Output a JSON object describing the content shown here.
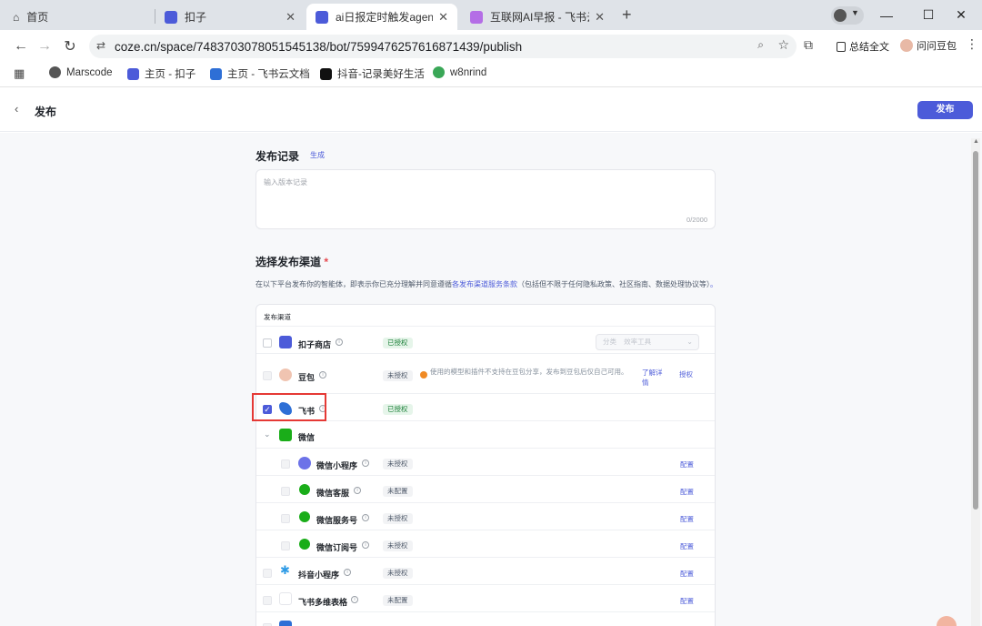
{
  "browser": {
    "tabs": [
      {
        "label": "首页"
      },
      {
        "label": "扣子"
      },
      {
        "label": "ai日报定时触发agent -"
      },
      {
        "label": "互联网AI早报 - 飞书云文"
      }
    ],
    "url": "coze.cn/space/7483703078051545138/bot/7599476257616871439/publish",
    "toolbar": {
      "summary": "总结全文",
      "assistant": "问问豆包"
    },
    "bookmarks": [
      {
        "label": "Marscode"
      },
      {
        "label": "主页 - 扣子"
      },
      {
        "label": "主页 - 飞书云文档"
      },
      {
        "label": "抖音-记录美好生活"
      },
      {
        "label": "w8nrind"
      }
    ]
  },
  "page": {
    "title": "发布",
    "publish_button": "发布",
    "record": {
      "title": "发布记录",
      "generate": "生成",
      "placeholder": "输入版本记录",
      "counter": "0/2000"
    },
    "channels": {
      "title": "选择发布渠道",
      "required_mark": "*",
      "notice_prefix": "在以下平台发布你的智能体，即表示你已充分理解并同意遵循",
      "notice_link": "各发布渠道服务条款",
      "notice_suffix": "（包括但不限于任何隐私政策、社区指南、数据处理协议等）",
      "notice_end": "。",
      "table_header": "发布渠道",
      "category_placeholder": "分类",
      "category_value": "效率工具",
      "rows": [
        {
          "name": "扣子商店",
          "badge": "已授权"
        },
        {
          "name": "豆包",
          "badge": "未授权",
          "warning": "使用的模型和插件不支持在豆包分享，发布到豆包后仅自己可用。",
          "learn_more": "了解详情",
          "action": "授权"
        },
        {
          "name": "飞书",
          "badge": "已授权"
        },
        {
          "name": "微信"
        },
        {
          "name": "微信小程序",
          "badge": "未授权",
          "action": "配置"
        },
        {
          "name": "微信客服",
          "badge": "未配置",
          "action": "配置"
        },
        {
          "name": "微信服务号",
          "badge": "未授权",
          "action": "配置"
        },
        {
          "name": "微信订阅号",
          "badge": "未授权",
          "action": "配置"
        },
        {
          "name": "抖音小程序",
          "badge": "未授权",
          "action": "配置"
        },
        {
          "name": "飞书多维表格",
          "badge": "未配置",
          "action": "配置"
        }
      ]
    }
  }
}
